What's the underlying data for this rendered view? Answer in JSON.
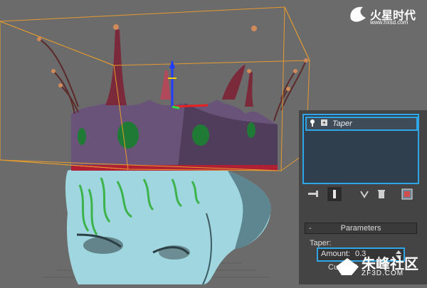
{
  "watermarks": {
    "top_brand": "火星时代",
    "top_url": "www.hxsd.com",
    "bottom_brand": "朱峰社区",
    "bottom_url": "ZF3D.COM"
  },
  "modifier_stack": {
    "items": [
      {
        "label": "Taper",
        "expand_glyph": "+"
      }
    ]
  },
  "toolbar": {
    "icons": [
      "pin-stack-icon",
      "show-end-result-icon",
      "make-unique-icon",
      "remove-modifier-icon",
      "configure-modifier-sets-icon"
    ]
  },
  "parameters": {
    "rollout_toggle": "-",
    "rollout_title": "Parameters",
    "group_label": "Taper:",
    "amount_label": "Amount:",
    "amount_value": "0.3",
    "curve_label": "Curve: 0"
  },
  "colors": {
    "highlight": "#2ea6e8",
    "crown_band": "#6a5378",
    "gem": "#1f7a35",
    "head": "#9fd6e0",
    "gizmo": "#e59b2e"
  }
}
